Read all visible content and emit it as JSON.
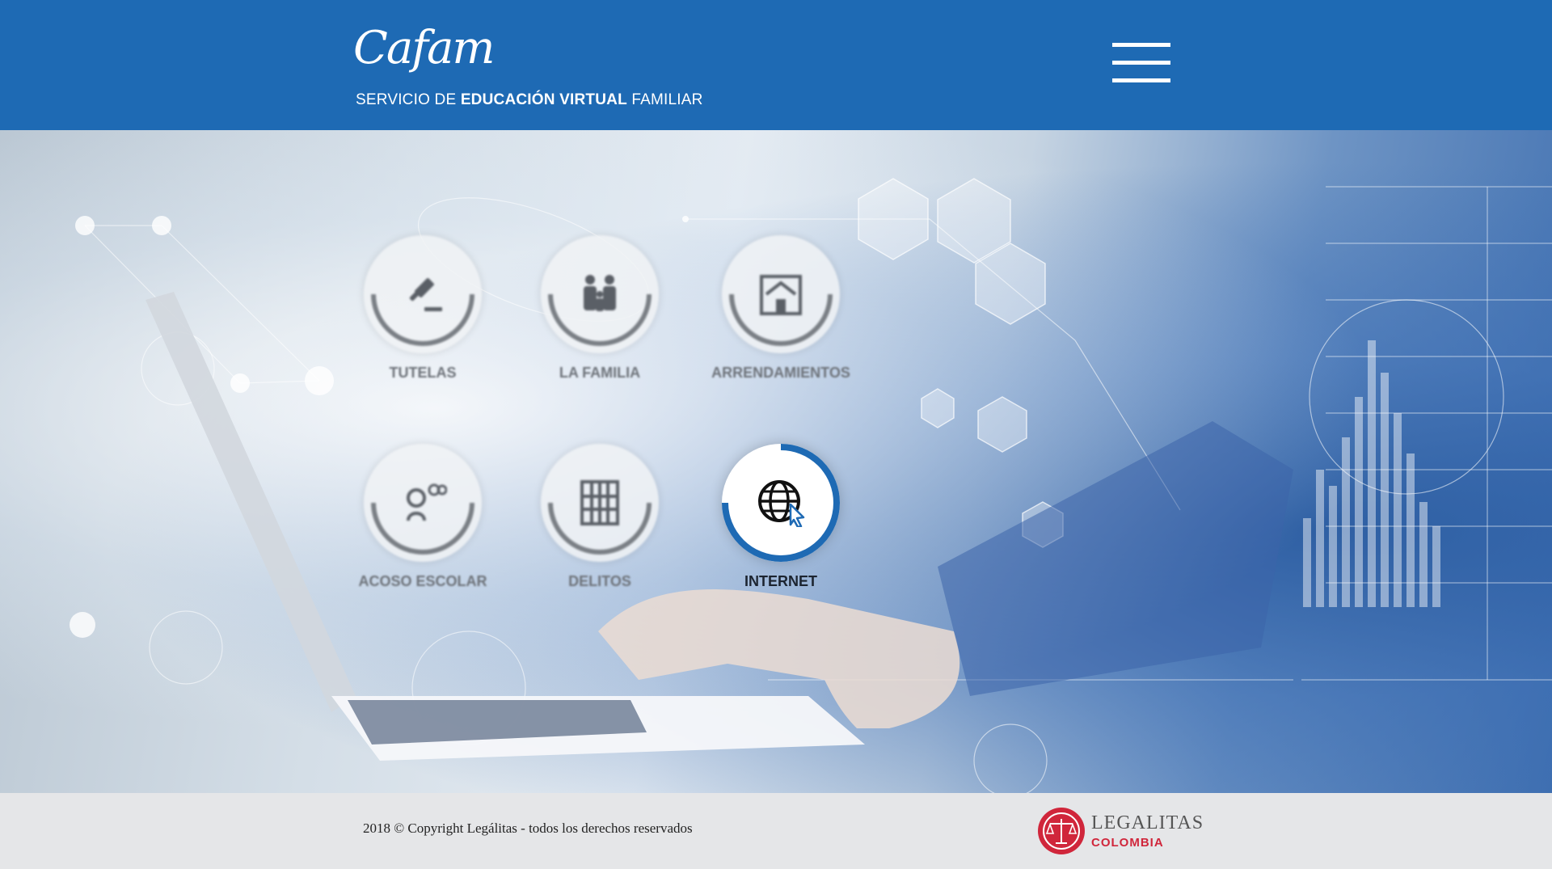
{
  "header": {
    "logo_text": "Cafam",
    "tagline_pre": "SERVICIO DE ",
    "tagline_bold": "EDUCACIÓN VIRTUAL",
    "tagline_post": " FAMILIAR",
    "menu_icon": "hamburger-menu-icon",
    "background_color": "#1e6ab4"
  },
  "categories": [
    {
      "label": "TUTELAS",
      "icon": "gavel-icon",
      "active": false
    },
    {
      "label": "LA FAMILIA",
      "icon": "family-icon",
      "active": false
    },
    {
      "label": "ARRENDAMIENTOS",
      "icon": "house-icon",
      "active": false
    },
    {
      "label": "ACOSO ESCOLAR",
      "icon": "bullying-icon",
      "active": false
    },
    {
      "label": "DELITOS",
      "icon": "jail-bars-icon",
      "active": false
    },
    {
      "label": "INTERNET",
      "icon": "globe-cursor-icon",
      "active": true
    }
  ],
  "footer": {
    "copyright": "2018 © Copyright Legálitas - todos los derechos reservados",
    "brand_name": "LEGALITAS",
    "brand_country": "COLOMBIA",
    "brand_color": "#d0263b"
  },
  "accent_color": "#1e6ab4"
}
